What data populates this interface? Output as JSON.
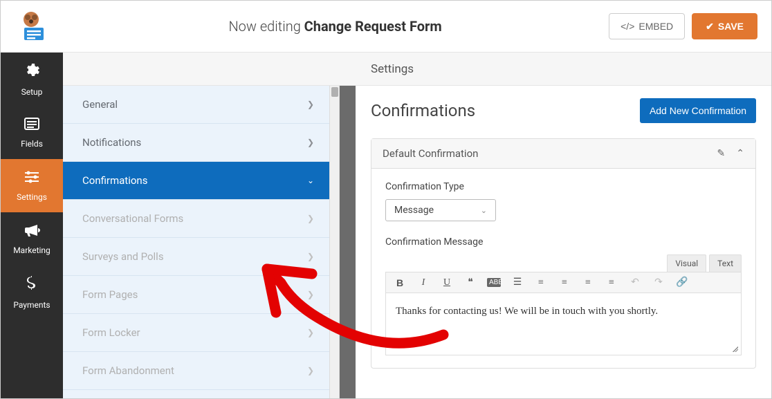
{
  "header": {
    "prefix": "Now editing ",
    "title": "Change Request Form",
    "embed_label": "EMBED",
    "save_label": "SAVE"
  },
  "nav": {
    "items": [
      {
        "label": "Setup",
        "icon": "gear"
      },
      {
        "label": "Fields",
        "icon": "list"
      },
      {
        "label": "Settings",
        "icon": "sliders",
        "active": true
      },
      {
        "label": "Marketing",
        "icon": "bullhorn"
      },
      {
        "label": "Payments",
        "icon": "dollar"
      }
    ]
  },
  "sidebar": {
    "items": [
      {
        "label": "General",
        "state": "normal"
      },
      {
        "label": "Notifications",
        "state": "normal"
      },
      {
        "label": "Confirmations",
        "state": "active"
      },
      {
        "label": "Conversational Forms",
        "state": "disabled"
      },
      {
        "label": "Surveys and Polls",
        "state": "disabled"
      },
      {
        "label": "Form Pages",
        "state": "disabled"
      },
      {
        "label": "Form Locker",
        "state": "disabled"
      },
      {
        "label": "Form Abandonment",
        "state": "disabled"
      }
    ]
  },
  "content": {
    "breadcrumb": "Settings",
    "title": "Confirmations",
    "add_button": "Add New Confirmation",
    "panel_title": "Default Confirmation",
    "fields": {
      "type_label": "Confirmation Type",
      "type_value": "Message",
      "message_label": "Confirmation Message",
      "message_body": "Thanks for contacting us! We will be in touch with you shortly."
    },
    "editor_tabs": {
      "visual": "Visual",
      "text": "Text"
    }
  }
}
